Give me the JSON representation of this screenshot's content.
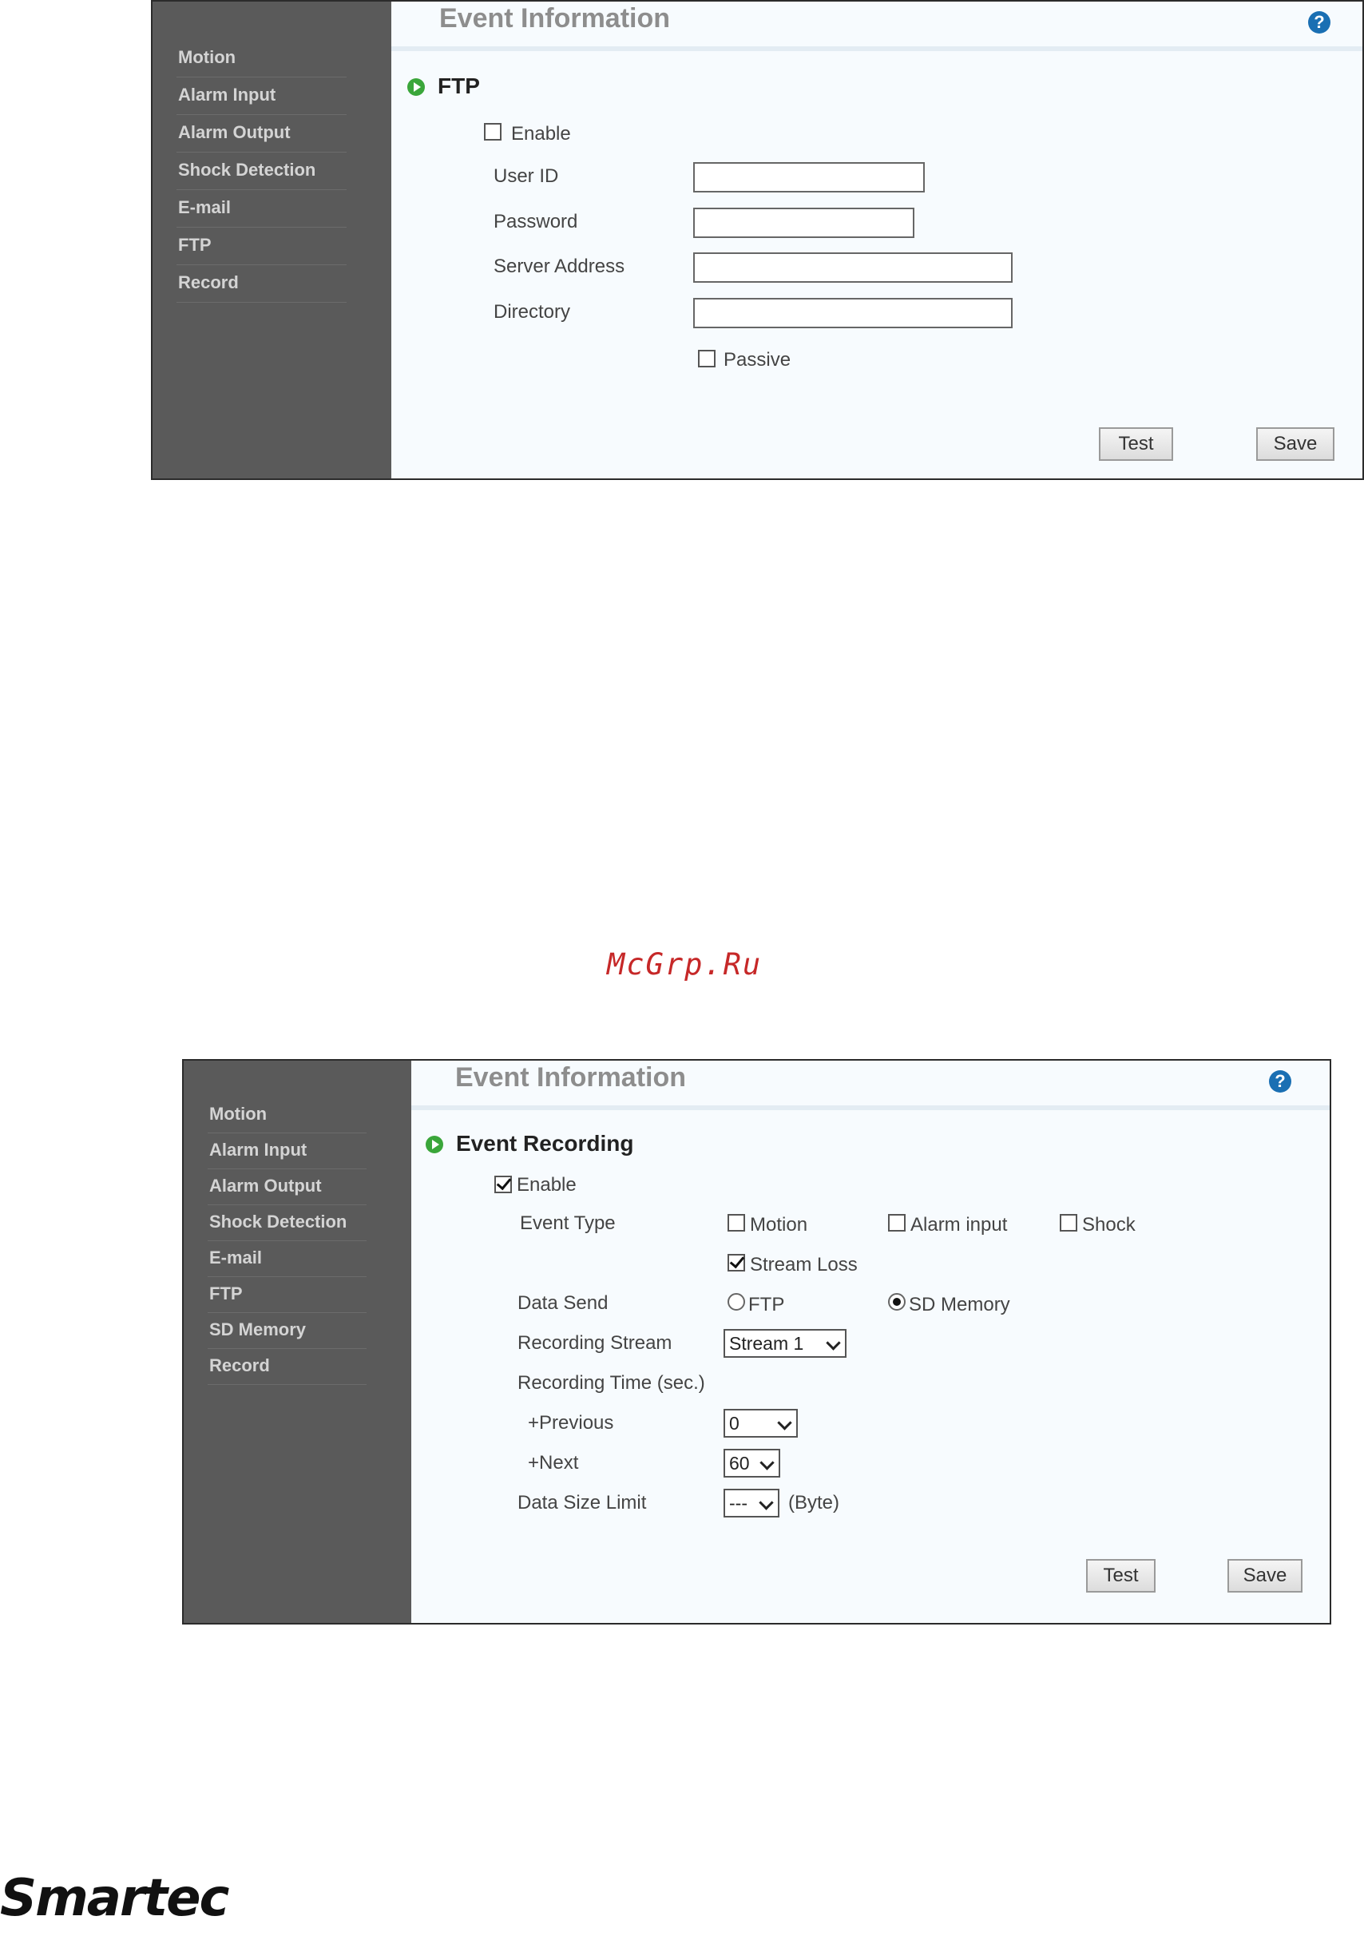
{
  "panel1": {
    "header": {
      "title": "Event Information"
    },
    "sidebar": {
      "items": [
        "Motion",
        "Alarm Input",
        "Alarm Output",
        "Shock Detection",
        "E-mail",
        "FTP",
        "Record"
      ]
    },
    "section": {
      "title": "FTP"
    },
    "enable_label": "Enable",
    "fields": {
      "user_id": {
        "label": "User ID",
        "value": ""
      },
      "password": {
        "label": "Password",
        "value": ""
      },
      "server_address": {
        "label": "Server Address",
        "value": ""
      },
      "directory": {
        "label": "Directory",
        "value": ""
      }
    },
    "passive_label": "Passive",
    "buttons": {
      "test": "Test",
      "save": "Save"
    }
  },
  "watermark": "McGrp.Ru",
  "panel2": {
    "header": {
      "title": "Event Information"
    },
    "sidebar": {
      "items": [
        "Motion",
        "Alarm Input",
        "Alarm Output",
        "Shock Detection",
        "E-mail",
        "FTP",
        "SD Memory",
        "Record"
      ]
    },
    "section": {
      "title": "Event Recording"
    },
    "enable_label": "Enable",
    "event_type": {
      "label": "Event Type",
      "options": {
        "motion": "Motion",
        "alarm_input": "Alarm input",
        "shock": "Shock",
        "stream_loss": "Stream Loss"
      }
    },
    "data_send": {
      "label": "Data Send",
      "ftp": "FTP",
      "sd_memory": "SD Memory"
    },
    "recording_stream": {
      "label": "Recording Stream",
      "value": "Stream 1"
    },
    "recording_time": {
      "label": "Recording Time (sec.)"
    },
    "previous": {
      "label": "+Previous",
      "value": "0"
    },
    "next": {
      "label": "+Next",
      "value": "60"
    },
    "data_size_limit": {
      "label": "Data Size Limit",
      "value": "---",
      "unit": "(Byte)"
    },
    "buttons": {
      "test": "Test",
      "save": "Save"
    }
  },
  "logo": {
    "text": "Smartec"
  }
}
